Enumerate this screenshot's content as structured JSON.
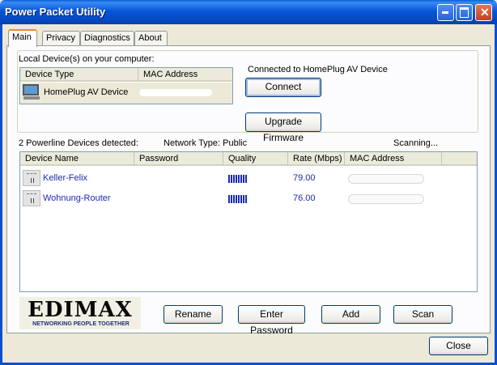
{
  "window": {
    "title": "Power Packet Utility"
  },
  "tabs": [
    {
      "label": "Main"
    },
    {
      "label": "Privacy"
    },
    {
      "label": "Diagnostics"
    },
    {
      "label": "About"
    }
  ],
  "local": {
    "section_label": "Local Device(s) on your computer:",
    "columns": [
      "Device Type",
      "MAC Address"
    ],
    "rows": [
      {
        "device_type": "HomePlug AV Device",
        "mac_address": ""
      }
    ]
  },
  "connection": {
    "status_text": "Connected to HomePlug AV Device",
    "connect_label": "Connect",
    "upgrade_label": "Upgrade Firmware"
  },
  "powerline": {
    "detected_text": "2 Powerline Devices detected:",
    "network_type": "Network Type: Public",
    "scan_status": "Scanning...",
    "columns": [
      "Device Name",
      "Password",
      "Quality",
      "Rate (Mbps)",
      "MAC Address"
    ],
    "rows": [
      {
        "name": "Keller-Felix",
        "password": "",
        "rate": "79.00",
        "mac": ""
      },
      {
        "name": "Wohnung-Router",
        "password": "",
        "rate": "76.00",
        "mac": ""
      }
    ]
  },
  "logo": {
    "brand": "EDIMAX",
    "tagline": "NETWORKING PEOPLE TOGETHER"
  },
  "actions": {
    "rename": "Rename",
    "enter_password": "Enter Password",
    "add": "Add",
    "scan": "Scan",
    "close": "Close"
  },
  "colors": {
    "titlebar": "#0756D6",
    "link_text": "#1A2AB0",
    "face": "#ECE9D8"
  },
  "icons": {
    "local_device": "computer-monitor-icon",
    "remote_device": "powerline-adapter-icon"
  }
}
